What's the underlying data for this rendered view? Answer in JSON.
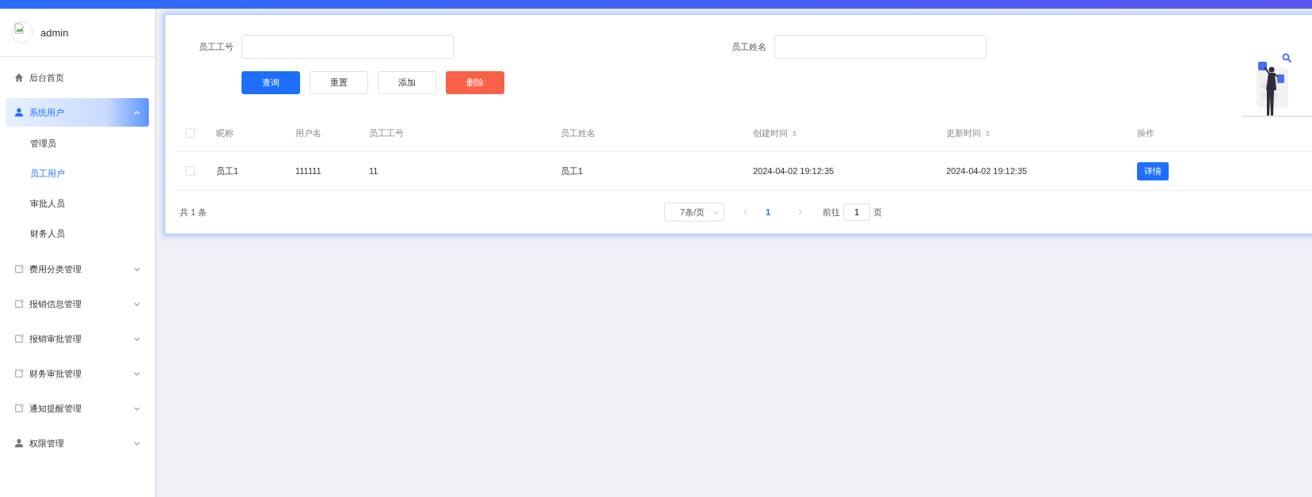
{
  "sidebar": {
    "user": {
      "name": "admin"
    },
    "items": [
      {
        "label": "后台首页",
        "kind": "home"
      },
      {
        "label": "系统用户",
        "kind": "people",
        "expanded": true,
        "selected": true,
        "children": [
          {
            "label": "管理员",
            "selected": false
          },
          {
            "label": "员工用户",
            "selected": true
          },
          {
            "label": "审批人员",
            "selected": false
          },
          {
            "label": "财务人员",
            "selected": false
          }
        ]
      },
      {
        "label": "费用分类管理",
        "kind": "section",
        "expanded": false,
        "selected": false
      },
      {
        "label": "报销信息管理",
        "kind": "section",
        "expanded": false,
        "selected": false
      },
      {
        "label": "报销审批管理",
        "kind": "section",
        "expanded": false,
        "selected": false
      },
      {
        "label": "财务审批管理",
        "kind": "section",
        "expanded": false,
        "selected": false
      },
      {
        "label": "通知提醒管理",
        "kind": "section",
        "expanded": false,
        "selected": false
      },
      {
        "label": "权限管理",
        "kind": "people",
        "expanded": false,
        "selected": false
      }
    ]
  },
  "search": {
    "fields": [
      {
        "label": "员工工号"
      },
      {
        "label": "员工姓名"
      }
    ],
    "buttons": [
      {
        "label": "查询",
        "kind": "primary"
      },
      {
        "label": "重置",
        "kind": "default"
      },
      {
        "label": "添加",
        "kind": "default"
      },
      {
        "label": "删除",
        "kind": "danger"
      }
    ]
  },
  "table": {
    "select_all_checked": false,
    "columns": [
      {
        "label": "昵称",
        "sortable": false
      },
      {
        "label": "用户名",
        "sortable": false
      },
      {
        "label": "员工工号",
        "sortable": false
      },
      {
        "label": "员工姓名",
        "sortable": false
      },
      {
        "label": "创建时间",
        "sortable": true
      },
      {
        "label": "更新时间",
        "sortable": true
      },
      {
        "label": "操作",
        "sortable": false
      }
    ],
    "rows": [
      {
        "selected": false,
        "cells": [
          "员工1",
          "111111",
          "11",
          "员工1",
          "2024-04-02 19:12:35",
          "2024-04-02 19:12:35"
        ],
        "action": "详情"
      }
    ]
  },
  "pagination": {
    "total": "共 1 条",
    "page_size": "7条/页",
    "pages": [
      {
        "label": "1",
        "selected": true
      }
    ],
    "goto_label": "前往",
    "goto_value": "1",
    "goto_suffix": "页"
  }
}
